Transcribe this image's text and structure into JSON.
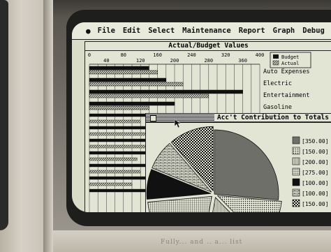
{
  "menu": {
    "apple_icon": "apple-logo",
    "items": [
      "File",
      "Edit",
      "Select",
      "Maintenance",
      "Report",
      "Graph",
      "Debug"
    ]
  },
  "budget_window": {
    "title": "Actual/Budget Values",
    "axis_ticks": [
      "0",
      "40",
      "80",
      "120",
      "160",
      "200",
      "240",
      "280",
      "320",
      "360",
      "400"
    ],
    "legend": [
      "Budget",
      "Actual"
    ],
    "categories": [
      "Auto Expenses",
      "Electric",
      "Entertainment",
      "Gasoline"
    ]
  },
  "contribution_window": {
    "title": "Acc't Contribution to Totals",
    "legend_values": [
      "[350.00]",
      "[150.00]",
      "[200.00]",
      "[275.00]",
      "[100.00]",
      "[100.00]",
      "[150.00]"
    ]
  },
  "chart_data": {
    "type": "bar",
    "title": "Actual/Budget Values",
    "xlim": [
      0,
      400
    ],
    "legend_placement": "top-right",
    "categories": [
      "Auto Expenses",
      "Electric",
      "Entertainment",
      "Gasoline"
    ],
    "series": [
      {
        "name": "Budget",
        "values": [
          140,
          180,
          360,
          200
        ]
      },
      {
        "name": "Actual",
        "values": [
          160,
          220,
          280,
          140
        ]
      }
    ],
    "pie_values": [
      350,
      150,
      200,
      275,
      100,
      100,
      150
    ]
  },
  "caption": "Fully... and .. a... list"
}
